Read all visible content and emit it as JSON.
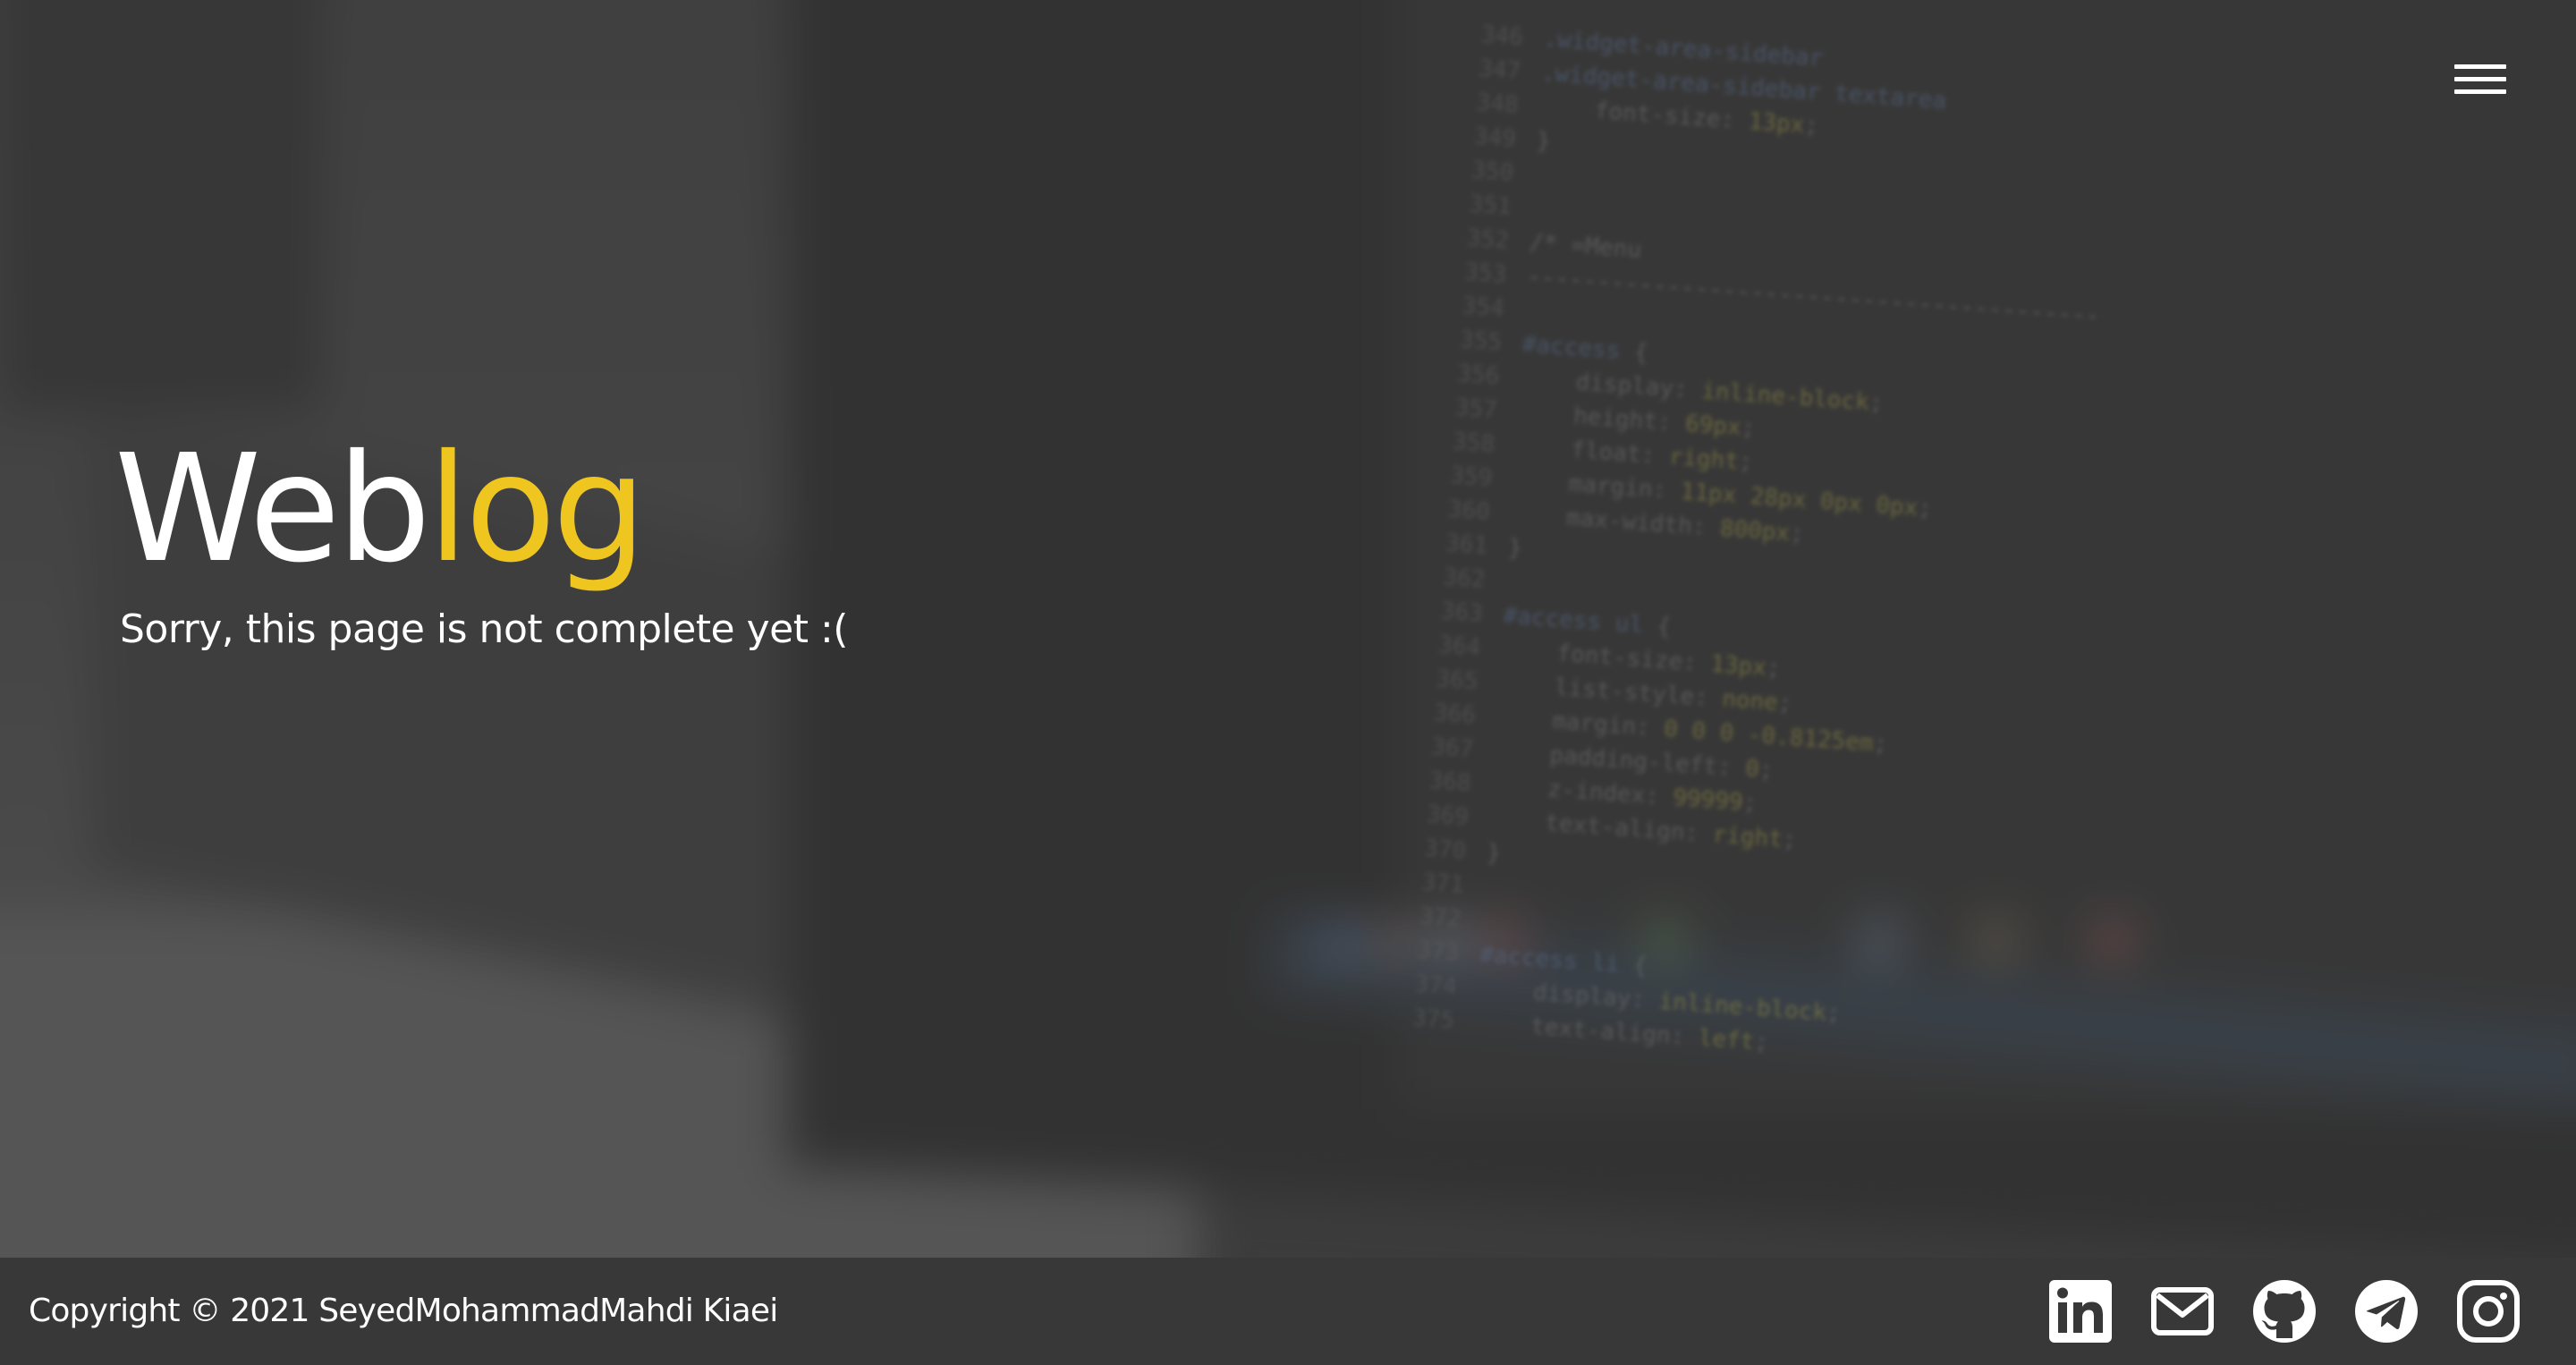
{
  "header": {
    "menu_icon": "hamburger-menu-icon"
  },
  "hero": {
    "title_part1": "Web",
    "title_part2": "log",
    "subtitle": "Sorry, this page is not complete yet :("
  },
  "footer": {
    "copyright": "Copyright © 2021 SeyedMohammadMahdi Kiaei",
    "social": [
      {
        "icon": "linkedin-icon"
      },
      {
        "icon": "email-icon"
      },
      {
        "icon": "github-icon"
      },
      {
        "icon": "telegram-icon"
      },
      {
        "icon": "instagram-icon"
      }
    ]
  },
  "colors": {
    "accent": "#eec61f",
    "text": "#ffffff",
    "footer_background": "#383838",
    "page_background": "#3a3a3a"
  }
}
